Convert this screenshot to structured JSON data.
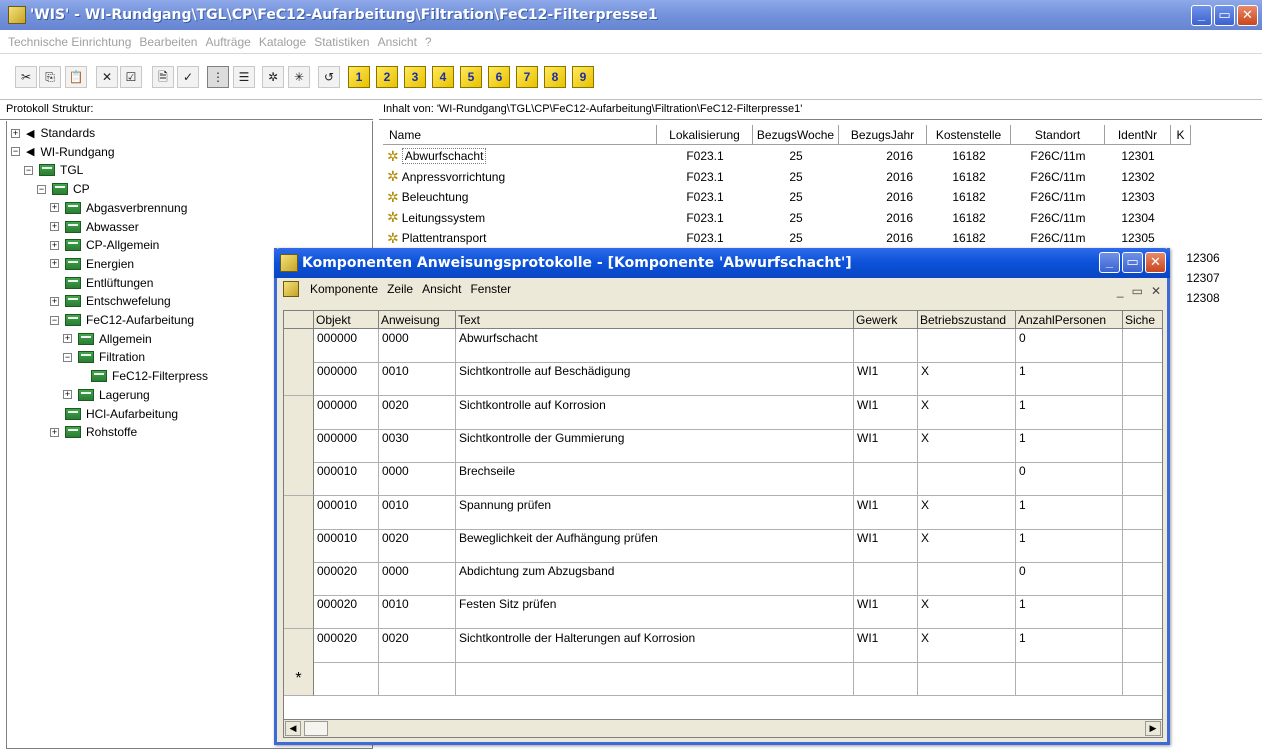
{
  "window": {
    "title": "'WIS' - WI-Rundgang\\TGL\\CP\\FeC12-Aufarbeitung\\Filtration\\FeC12-Filterpresse1",
    "minimize": "_",
    "maximize": "▭",
    "close": "✕"
  },
  "menu": [
    "Technische Einrichtung",
    "Bearbeiten",
    "Aufträge",
    "Kataloge",
    "Statistiken",
    "Ansicht",
    "?"
  ],
  "toolbar": {
    "icons": [
      {
        "name": "cut-icon",
        "glyph": "✂"
      },
      {
        "name": "copy-icon",
        "glyph": "⎘"
      },
      {
        "name": "paste-icon",
        "glyph": "📋"
      },
      {
        "name": "delete-icon",
        "glyph": "✕"
      },
      {
        "name": "properties-icon",
        "glyph": "☑"
      },
      {
        "name": "document-icon",
        "glyph": "🗎"
      },
      {
        "name": "check-document-icon",
        "glyph": "✓"
      },
      {
        "name": "tree-view-icon",
        "glyph": "⋮"
      },
      {
        "name": "list-view-icon",
        "glyph": "☰"
      },
      {
        "name": "component-icon",
        "glyph": "✲"
      },
      {
        "name": "component-list-icon",
        "glyph": "✳"
      },
      {
        "name": "undo-icon",
        "glyph": "↺"
      }
    ],
    "levels": [
      "1",
      "2",
      "3",
      "4",
      "5",
      "6",
      "7",
      "8",
      "9"
    ]
  },
  "left_panel": {
    "header": "Protokoll Struktur:",
    "tree": [
      {
        "label": "Standards",
        "depth": 0,
        "expander": "+",
        "icon": "arrow"
      },
      {
        "label": "WI-Rundgang",
        "depth": 0,
        "expander": "−",
        "icon": "arrow"
      },
      {
        "label": "TGL",
        "depth": 1,
        "expander": "−",
        "icon": "folder"
      },
      {
        "label": "CP",
        "depth": 2,
        "expander": "−",
        "icon": "folder"
      },
      {
        "label": "Abgasverbrennung",
        "depth": 3,
        "expander": "+",
        "icon": "folder"
      },
      {
        "label": "Abwasser",
        "depth": 3,
        "expander": "+",
        "icon": "folder"
      },
      {
        "label": "CP-Allgemein",
        "depth": 3,
        "expander": "+",
        "icon": "folder"
      },
      {
        "label": "Energien",
        "depth": 3,
        "expander": "+",
        "icon": "folder"
      },
      {
        "label": "Entlüftungen",
        "depth": 3,
        "expander": "",
        "icon": "folder"
      },
      {
        "label": "Entschwefelung",
        "depth": 3,
        "expander": "+",
        "icon": "folder"
      },
      {
        "label": "FeC12-Aufarbeitung",
        "depth": 3,
        "expander": "−",
        "icon": "folder"
      },
      {
        "label": "Allgemein",
        "depth": 4,
        "expander": "+",
        "icon": "folder"
      },
      {
        "label": "Filtration",
        "depth": 4,
        "expander": "−",
        "icon": "folder"
      },
      {
        "label": "FeC12-Filterpress",
        "depth": 5,
        "expander": "",
        "icon": "folder"
      },
      {
        "label": "Lagerung",
        "depth": 4,
        "expander": "+",
        "icon": "folder"
      },
      {
        "label": "HCl-Aufarbeitung",
        "depth": 3,
        "expander": "",
        "icon": "folder"
      },
      {
        "label": "Rohstoffe",
        "depth": 3,
        "expander": "+",
        "icon": "folder"
      }
    ]
  },
  "right_panel": {
    "header": "Inhalt von: 'WI-Rundgang\\TGL\\CP\\FeC12-Aufarbeitung\\Filtration\\FeC12-Filterpresse1'",
    "columns": [
      "Name",
      "Lokalisierung",
      "BezugsWoche",
      "BezugsJahr",
      "Kostenstelle",
      "Standort",
      "IdentNr",
      "K"
    ],
    "rows": [
      {
        "name": "Abwurfschacht",
        "lok": "F023.1",
        "woche": "25",
        "jahr": "2016",
        "kst": "16182",
        "standort": "F26C/11m",
        "ident": "12301"
      },
      {
        "name": "Anpressvorrichtung",
        "lok": "F023.1",
        "woche": "25",
        "jahr": "2016",
        "kst": "16182",
        "standort": "F26C/11m",
        "ident": "12302"
      },
      {
        "name": "Beleuchtung",
        "lok": "F023.1",
        "woche": "25",
        "jahr": "2016",
        "kst": "16182",
        "standort": "F26C/11m",
        "ident": "12303"
      },
      {
        "name": "Leitungssystem",
        "lok": "F023.1",
        "woche": "25",
        "jahr": "2016",
        "kst": "16182",
        "standort": "F26C/11m",
        "ident": "12304"
      },
      {
        "name": "Plattentransport",
        "lok": "F023.1",
        "woche": "25",
        "jahr": "2016",
        "kst": "16182",
        "standort": "F26C/11m",
        "ident": "12305"
      }
    ],
    "extra_ident": [
      "12306",
      "12307",
      "12308"
    ]
  },
  "child_window": {
    "title": "Komponenten Anweisungsprotokolle - [Komponente 'Abwurfschacht']",
    "menu": [
      "Komponente",
      "Zeile",
      "Ansicht",
      "Fenster"
    ],
    "mdi_buttons": [
      "_",
      "▭",
      "✕"
    ],
    "columns": [
      "Objekt",
      "Anweisung",
      "Text",
      "Gewerk",
      "Betriebszustand",
      "AnzahlPersonen",
      "Siche"
    ],
    "rows": [
      {
        "objekt": "000000",
        "anweisung": "0000",
        "text": "Abwurfschacht",
        "gewerk": "",
        "betrieb": "",
        "anzahl": "0"
      },
      {
        "objekt": "000000",
        "anweisung": "0010",
        "text": "Sichtkontrolle auf Beschädigung",
        "gewerk": "WI1",
        "betrieb": "X",
        "anzahl": "1"
      },
      {
        "objekt": "000000",
        "anweisung": "0020",
        "text": "Sichtkontrolle auf Korrosion",
        "gewerk": "WI1",
        "betrieb": "X",
        "anzahl": "1"
      },
      {
        "objekt": "000000",
        "anweisung": "0030",
        "text": "Sichtkontrolle der Gummierung",
        "gewerk": "WI1",
        "betrieb": "X",
        "anzahl": "1"
      },
      {
        "objekt": "000010",
        "anweisung": "0000",
        "text": "Brechseile",
        "gewerk": "",
        "betrieb": "",
        "anzahl": "0"
      },
      {
        "objekt": "000010",
        "anweisung": "0010",
        "text": "Spannung prüfen",
        "gewerk": "WI1",
        "betrieb": "X",
        "anzahl": "1"
      },
      {
        "objekt": "000010",
        "anweisung": "0020",
        "text": "Beweglichkeit der Aufhängung prüfen",
        "gewerk": "WI1",
        "betrieb": "X",
        "anzahl": "1"
      },
      {
        "objekt": "000020",
        "anweisung": "0000",
        "text": "Abdichtung zum Abzugsband",
        "gewerk": "",
        "betrieb": "",
        "anzahl": "0"
      },
      {
        "objekt": "000020",
        "anweisung": "0010",
        "text": "Festen Sitz prüfen",
        "gewerk": "WI1",
        "betrieb": "X",
        "anzahl": "1"
      },
      {
        "objekt": "000020",
        "anweisung": "0020",
        "text": "Sichtkontrolle der Halterungen auf Korrosion",
        "gewerk": "WI1",
        "betrieb": "X",
        "anzahl": "1"
      }
    ],
    "new_row_marker": "*"
  }
}
